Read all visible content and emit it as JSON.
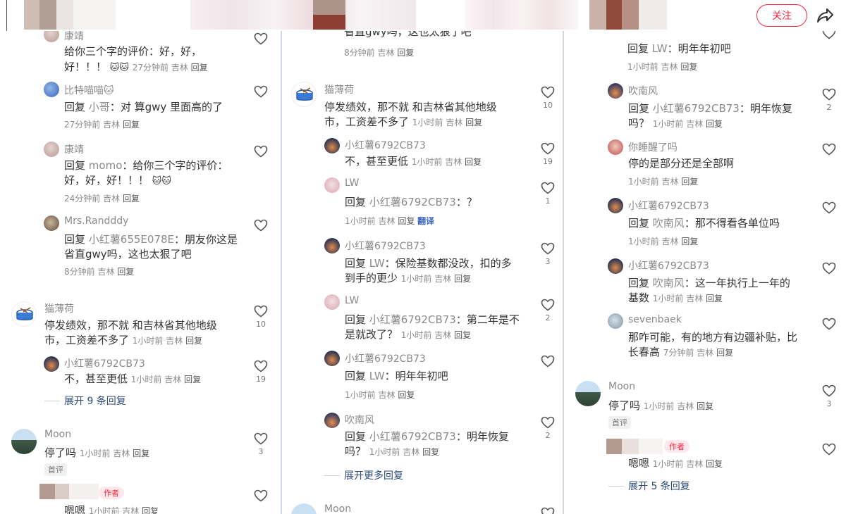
{
  "header": {
    "follow_label": "关注",
    "colors": {
      "accent": "#ff2442",
      "link": "#2b4a7a"
    }
  },
  "panel1": {
    "c1": {
      "name": "康靖",
      "text1": "给你三个字的评价：好，好，",
      "text2": "好！！！",
      "emoji": "🐱🐱",
      "time": "27分钟前",
      "loc": "吉林",
      "reply": "回复"
    },
    "c2": {
      "name": "比特喵喵🐱",
      "prefix": "回复",
      "target": "小哥",
      "text": "：对 算gwy 里面高的了",
      "time": "27分钟前",
      "loc": "吉林",
      "reply": "回复"
    },
    "c3": {
      "name": "康靖",
      "prefix": "回复",
      "target": "momo",
      "text1": "：给你三个字的评价：",
      "text2": "好，好，好！！！",
      "emoji": "🐱🐱",
      "time": "24分钟前",
      "loc": "吉林",
      "reply": "回复"
    },
    "c4": {
      "name": "Mrs.Randddy",
      "prefix": "回复",
      "target": "小红薯655E078E",
      "text1": "：朋友你这是",
      "text2": "省直gwy吗，这也太狠了吧",
      "time": "8分钟前",
      "loc": "吉林",
      "reply": "回复"
    },
    "c5": {
      "name": "猫薄荷",
      "text1": "停发绩效，那不就 和吉林省其他地级",
      "text2": "市，工资差不多了",
      "time": "1小时前",
      "loc": "吉林",
      "reply": "回复",
      "likes": "10"
    },
    "c6": {
      "name": "小红薯6792CB73",
      "text": "不，甚至更低",
      "time": "1小时前",
      "loc": "吉林",
      "reply": "回复",
      "likes": "19"
    },
    "expand": "展开 9 条回复",
    "c7": {
      "name": "Moon",
      "text": "停了吗",
      "time": "1小时前",
      "loc": "吉林",
      "reply": "回复",
      "likes": "3",
      "badge": "首评"
    },
    "c8": {
      "tag": "作者",
      "text": "嗯嗯",
      "time": "1小时前",
      "loc": "吉林",
      "reply": "回复"
    }
  },
  "panel2": {
    "top": {
      "text": "省直gwy吗，这也太狠了吧",
      "time": "8分钟前",
      "loc": "吉林",
      "reply": "回复"
    },
    "c1": {
      "name": "猫薄荷",
      "text1": "停发绩效，那不就 和吉林省其他地级",
      "text2": "市，工资差不多了",
      "time": "1小时前",
      "loc": "吉林",
      "reply": "回复",
      "likes": "10"
    },
    "c2": {
      "name": "小红薯6792CB73",
      "text": "不，甚至更低",
      "time": "1小时前",
      "loc": "吉林",
      "reply": "回复",
      "likes": "19"
    },
    "c3": {
      "name": "LW",
      "prefix": "回复",
      "target": "小红薯6792CB73",
      "text": "：？",
      "time": "1小时前",
      "loc": "吉林",
      "reply": "回复",
      "translate": "翻译",
      "likes": "1"
    },
    "c4": {
      "name": "小红薯6792CB73",
      "prefix": "回复",
      "target": "LW",
      "text1": "：保险基数都没改，扣的多",
      "text2": "到手的更少",
      "time": "1小时前",
      "loc": "吉林",
      "reply": "回复",
      "likes": "3"
    },
    "c5": {
      "name": "LW",
      "prefix": "回复",
      "target": "小红薯6792CB73",
      "text1": "：第二年是不",
      "text2": "是就改了？",
      "time": "1小时前",
      "loc": "吉林",
      "reply": "回复",
      "likes": "2"
    },
    "c6": {
      "name": "小红薯6792CB73",
      "prefix": "回复",
      "target": "LW",
      "text": "：明年年初吧",
      "time": "1小时前",
      "loc": "吉林",
      "reply": "回复"
    },
    "c7": {
      "name": "吹南风",
      "prefix": "回复",
      "target": "小红薯6792CB73",
      "text1": "：明年恢复",
      "text2": "吗？",
      "time": "1小时前",
      "loc": "吉林",
      "reply": "回复",
      "likes": "2"
    },
    "expand": "展开更多回复",
    "c8": {
      "name": "Moon"
    }
  },
  "panel3": {
    "top": {
      "prefix": "回复",
      "target": "LW",
      "text": "：明年年初吧",
      "time": "1小时前",
      "loc": "吉林",
      "reply": "回复"
    },
    "c1": {
      "name": "吹南风",
      "prefix": "回复",
      "target": "小红薯6792CB73",
      "text1": "：明年恢复",
      "text2": "吗？",
      "time": "1小时前",
      "loc": "吉林",
      "reply": "回复",
      "likes": "2"
    },
    "c2": {
      "name": "你睡醒了吗",
      "text": "停的是部分还是全部啊",
      "time": "1小时前",
      "loc": "吉林",
      "reply": "回复"
    },
    "c3": {
      "name": "小红薯6792CB73",
      "prefix": "回复",
      "target": "吹南风",
      "text": "：那不得看各单位吗",
      "time": "1小时前",
      "loc": "吉林",
      "reply": "回复"
    },
    "c4": {
      "name": "小红薯6792CB73",
      "prefix": "回复",
      "target": "吹南风",
      "text1": "：这一年执行上一年的",
      "text2": "基数",
      "time": "1小时前",
      "loc": "吉林",
      "reply": "回复"
    },
    "c5": {
      "name": "sevenbaek",
      "text1": "那咋可能，有的地方有边疆补贴，比",
      "text2": "长春高",
      "time": "7分钟前",
      "loc": "吉林",
      "reply": "回复"
    },
    "c6": {
      "name": "Moon",
      "text": "停了吗",
      "time": "1小时前",
      "loc": "吉林",
      "reply": "回复",
      "likes": "3",
      "badge": "首评"
    },
    "c7": {
      "tag": "作者",
      "text": "嗯嗯",
      "time": "1小时前",
      "loc": "吉林",
      "reply": "回复"
    },
    "expand": "展开 5 条回复"
  }
}
